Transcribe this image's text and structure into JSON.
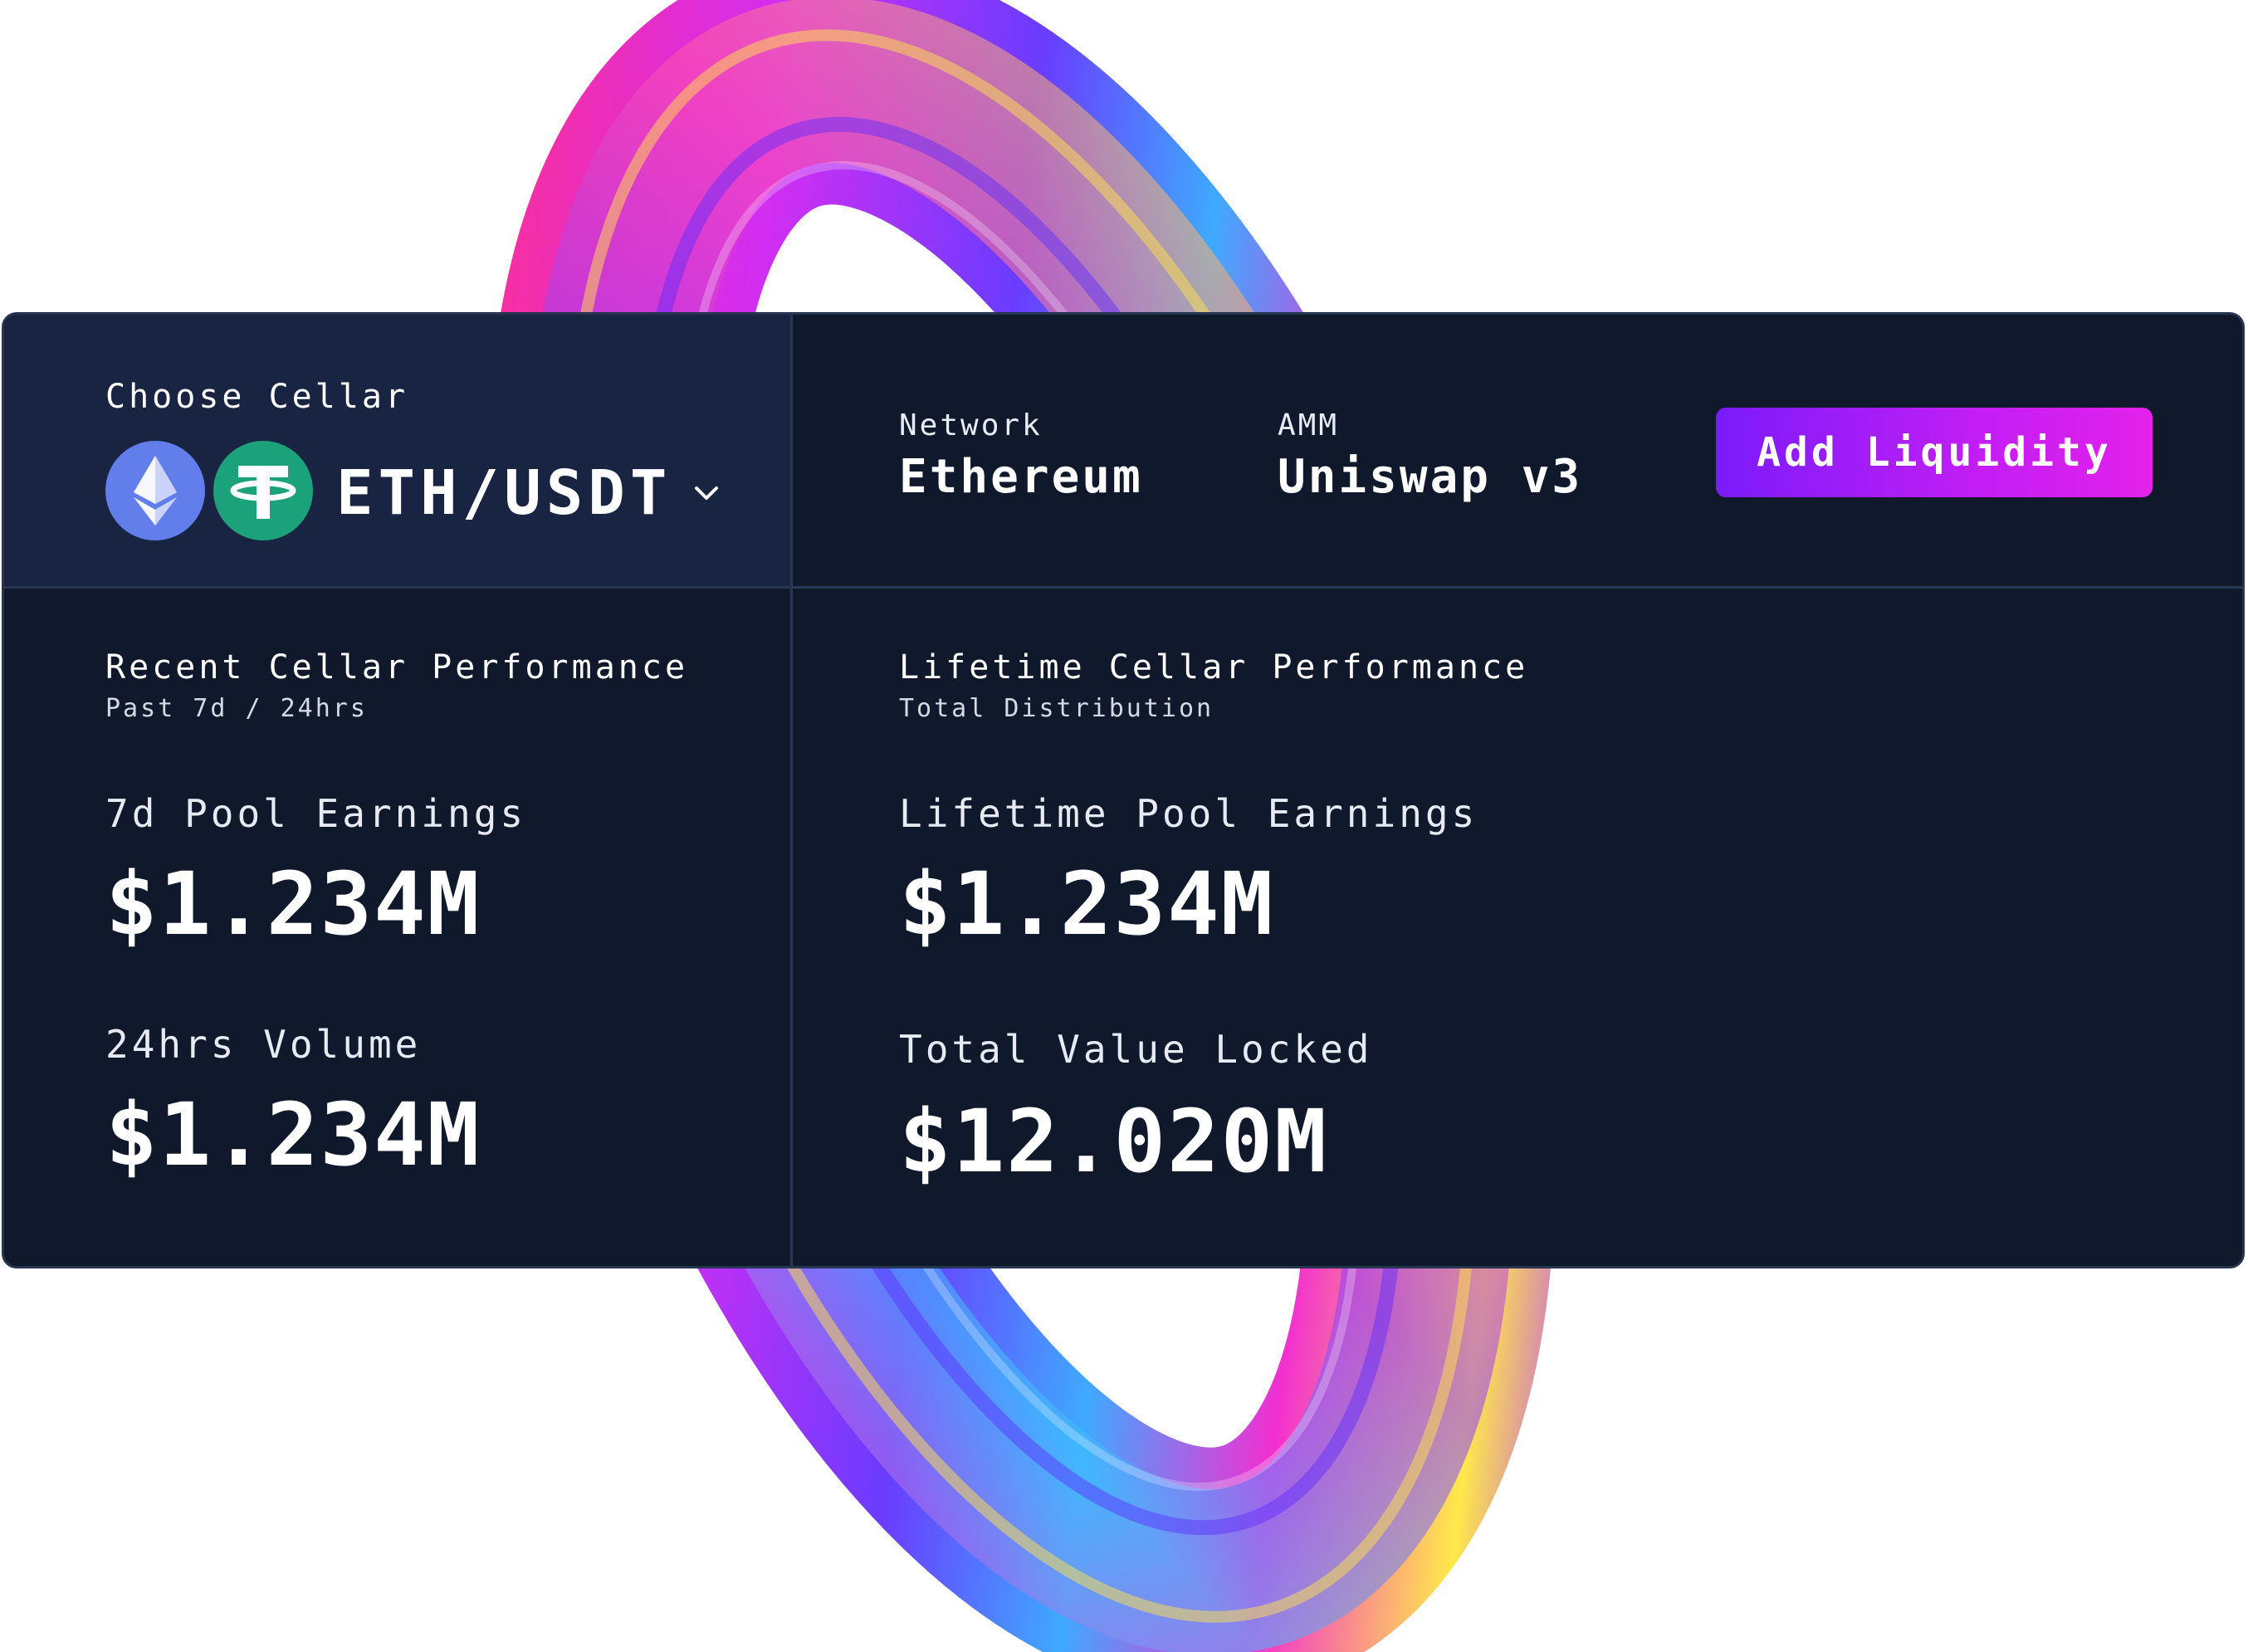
{
  "choose": {
    "label": "Choose Cellar",
    "pair": "ETH/USDT",
    "tokens": [
      {
        "symbol": "ETH",
        "icon": "ethereum-icon",
        "color": "#627eea"
      },
      {
        "symbol": "USDT",
        "icon": "tether-icon",
        "color": "#1ba27a"
      }
    ]
  },
  "network": {
    "label": "Network",
    "value": "Ethereum"
  },
  "amm": {
    "label": "AMM",
    "value": "Uniswap v3"
  },
  "actions": {
    "add_liquidity": "Add Liquidity"
  },
  "recent": {
    "title": "Recent Cellar Performance",
    "subtitle": "Past 7d / 24hrs",
    "metrics": [
      {
        "label": "7d Pool Earnings",
        "value": "$1.234M"
      },
      {
        "label": "24hrs Volume",
        "value": "$1.234M"
      }
    ]
  },
  "lifetime": {
    "title": "Lifetime Cellar Performance",
    "subtitle": "Total Distribution",
    "metrics": [
      {
        "label": "Lifetime Pool Earnings",
        "value": "$1.234M"
      },
      {
        "label": "Total Value Locked",
        "value": "$12.020M"
      }
    ]
  },
  "colors": {
    "card_bg": "#0f192b",
    "header_bg": "#182442",
    "accent_start": "#7a1cfa",
    "accent_end": "#e322ea"
  }
}
